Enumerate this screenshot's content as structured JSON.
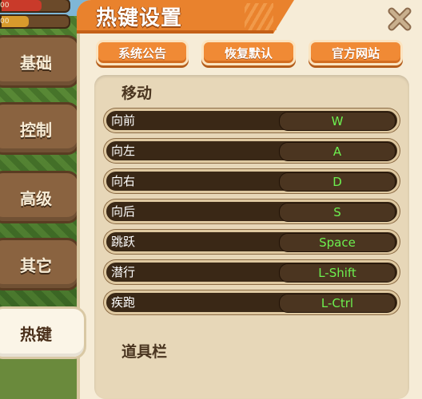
{
  "hud": {
    "bar1_value": "00",
    "bar2_value": "00"
  },
  "colors": {
    "accent": "#e9822d",
    "key_text": "#6df04f",
    "panel_bg": "#f6ecd7"
  },
  "sidebar": {
    "tabs": [
      {
        "label": "基础",
        "active": false
      },
      {
        "label": "控制",
        "active": false
      },
      {
        "label": "高级",
        "active": false
      },
      {
        "label": "其它",
        "active": false
      },
      {
        "label": "热键",
        "active": true
      }
    ]
  },
  "panel": {
    "title": "热键设置",
    "close_icon": "close-x-icon",
    "buttons": {
      "announcement": "系统公告",
      "restore_default": "恢复默认",
      "official_site": "官方网站"
    }
  },
  "sections": [
    {
      "title": "移动",
      "bindings": [
        {
          "action": "向前",
          "key": "W"
        },
        {
          "action": "向左",
          "key": "A"
        },
        {
          "action": "向右",
          "key": "D"
        },
        {
          "action": "向后",
          "key": "S"
        },
        {
          "action": "跳跃",
          "key": "Space"
        },
        {
          "action": "潜行",
          "key": "L-Shift"
        },
        {
          "action": "疾跑",
          "key": "L-Ctrl"
        }
      ]
    },
    {
      "title": "道具栏"
    }
  ]
}
